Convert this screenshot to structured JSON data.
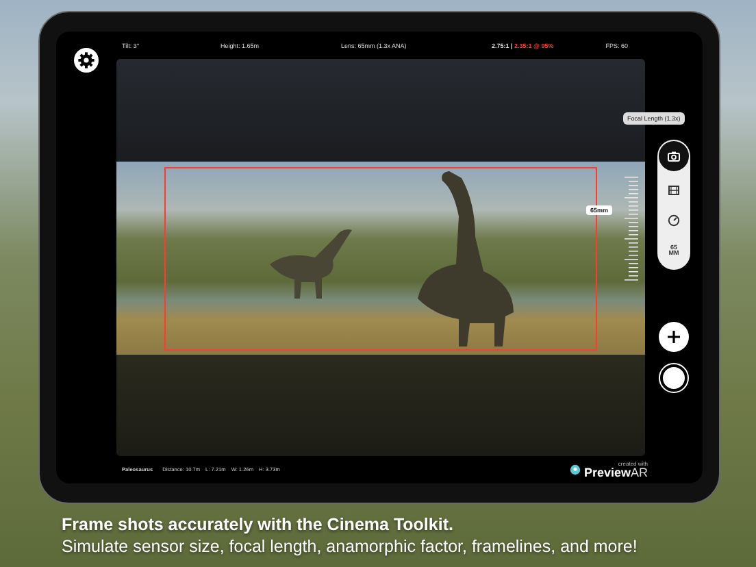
{
  "hud": {
    "tilt": "Tilt: 3°",
    "height": "Height: 1.65m",
    "lens": "Lens: 65mm (1.3x ANA)",
    "aspect": "2.75:1 |",
    "frameline": "2.35:1 @ 95%",
    "fps": "FPS: 60"
  },
  "focal_tooltip": "Focal Length (1.3x)",
  "frame_tag": "65mm",
  "tools": [
    {
      "kind": "camera",
      "selected": true
    },
    {
      "kind": "film",
      "selected": false
    },
    {
      "kind": "gauge",
      "selected": false
    },
    {
      "kind": "focal",
      "selected": false,
      "value": "65",
      "unit": "MM"
    }
  ],
  "info": [
    "Paleosaurus",
    "Distance: 10.7m",
    "L: 7.21m",
    "W: 1.26m",
    "H: 3.73m"
  ],
  "logo": {
    "caption": "created with",
    "word": "Preview",
    "suffix": "AR"
  },
  "headline": "Frame shots accurately with the Cinema Toolkit.",
  "subline": "Simulate sensor size, focal length, anamorphic factor, framelines, and more!"
}
